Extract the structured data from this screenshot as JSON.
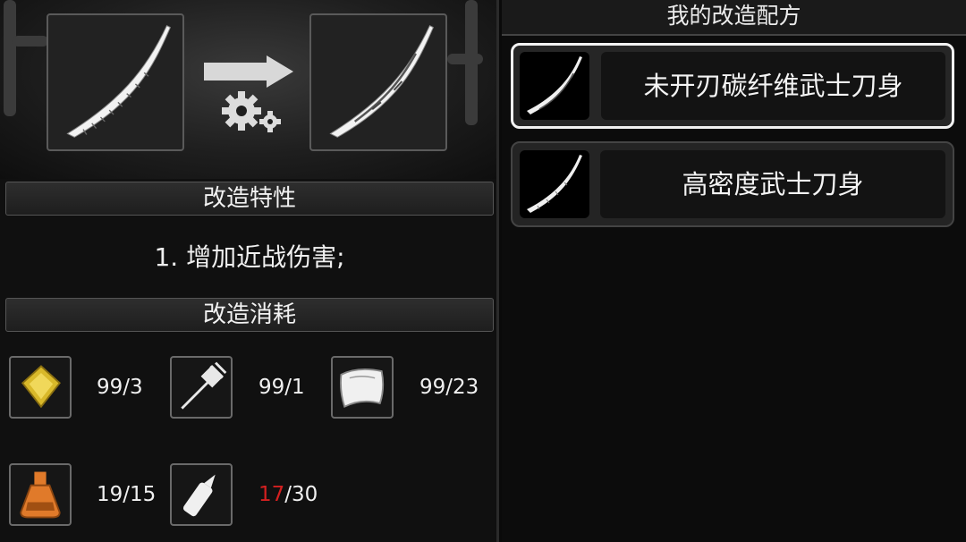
{
  "modify": {
    "traits_header": "改造特性",
    "trait_lines": [
      "1. 增加近战伤害;"
    ],
    "cost_header": "改造消耗",
    "materials": [
      {
        "icon": "gold-plate-icon",
        "have": "99",
        "need": "3",
        "short": false
      },
      {
        "icon": "drill-part-icon",
        "have": "99",
        "need": "1",
        "short": false
      },
      {
        "icon": "cloth-icon",
        "have": "99",
        "need": "23",
        "short": false
      },
      {
        "icon": "chemical-flask-icon",
        "have": "19",
        "need": "15",
        "short": false
      },
      {
        "icon": "glue-bottle-icon",
        "have": "17",
        "need": "30",
        "short": true
      }
    ],
    "source_item_icon": "katana-blade-icon",
    "result_item_icon": "carbon-katana-blade-icon"
  },
  "recipes": {
    "title": "我的改造配方",
    "items": [
      {
        "name": "未开刃碳纤维武士刀身",
        "selected": true,
        "icon": "carbon-katana-blade-icon"
      },
      {
        "name": "高密度武士刀身",
        "selected": false,
        "icon": "katana-blade-icon"
      }
    ]
  },
  "colors": {
    "shortage": "#d42020",
    "gold": "#d9b92a",
    "accent_orange": "#e07a2a"
  }
}
